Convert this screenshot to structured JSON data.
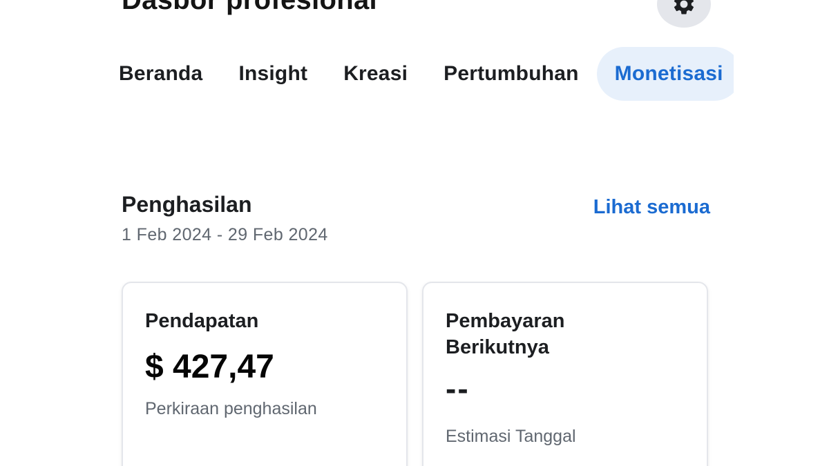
{
  "header": {
    "title": "Dasbor profesional",
    "settings_icon": "gear-icon"
  },
  "tabs": [
    {
      "label": "Beranda",
      "active": false
    },
    {
      "label": "Insight",
      "active": false
    },
    {
      "label": "Kreasi",
      "active": false
    },
    {
      "label": "Pertumbuhan",
      "active": false
    },
    {
      "label": "Monetisasi",
      "active": true
    }
  ],
  "earnings": {
    "title": "Penghasilan",
    "date_range": "1 Feb 2024 - 29 Feb 2024",
    "see_all_label": "Lihat semua"
  },
  "cards": {
    "revenue": {
      "title": "Pendapatan",
      "amount": "$ 427,47",
      "caption": "Perkiraan penghasilan"
    },
    "next_payment": {
      "title": "Pembayaran Berikutnya",
      "value": "--",
      "caption": "Estimasi Tanggal"
    }
  },
  "colors": {
    "accent": "#1b6bd1",
    "active_tab_bg": "#e7f0fb",
    "muted_text": "#606770"
  }
}
